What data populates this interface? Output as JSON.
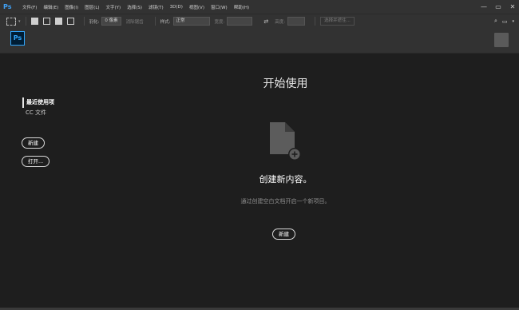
{
  "menubar": {
    "logo": "Ps",
    "items": [
      "文件(F)",
      "编辑(E)",
      "图像(I)",
      "图层(L)",
      "文字(Y)",
      "选择(S)",
      "滤镜(T)",
      "3D(D)",
      "视图(V)",
      "窗口(W)",
      "帮助(H)"
    ],
    "window_controls": [
      "—",
      "▭",
      "✕"
    ]
  },
  "options": {
    "feather_label": "羽化:",
    "feather_value": "0 像素",
    "antialias": "消除锯齿",
    "style_label": "样式:",
    "style_value": "正常",
    "width_label": "宽度:",
    "height_label": "高度:",
    "select_mask": "选择并遮住..."
  },
  "header": {
    "badge": "Ps"
  },
  "start": {
    "title": "开始使用",
    "nav": [
      {
        "label": "最近使用项",
        "active": true
      },
      {
        "label": "CC 文件",
        "active": false
      }
    ],
    "side_new_label": "新建",
    "side_open_label": "打开...",
    "create_title": "创建新内容。",
    "create_subtitle": "通过创建空白文档开启一个新项目。",
    "center_new_label": "新建"
  },
  "colors": {
    "ui_bg": "#323232",
    "content_bg": "#1e1e1e",
    "ps_blue": "#31a8ff"
  }
}
